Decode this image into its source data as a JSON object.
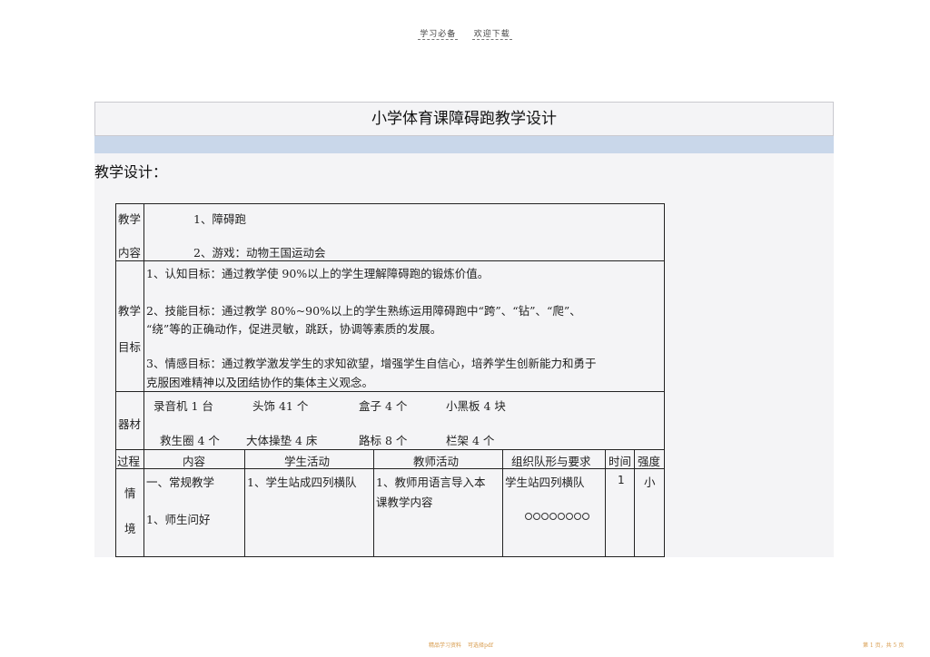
{
  "header": {
    "left": "学习必备",
    "right": "欢迎下载"
  },
  "doc": {
    "title": "小学体育课障碍跑教学设计",
    "section_label": "教学设计："
  },
  "content_row": {
    "label1": "教学",
    "label2": "内容",
    "line1": "1、障碍跑",
    "line2": "2、游戏：动物王国运动会"
  },
  "goals_row": {
    "label1": "教学",
    "label2": "目标",
    "g1": "1、认知目标：通过教学使 90%以上的学生理解障碍跑的锻炼价值。",
    "g2a": "2、技能目标：通过教学 80%~90%以上的学生熟练运用障碍跑中“跨”、“钻”、“爬”、",
    "g2b": "“绕”等的正确动作，促进灵敏，跳跃，协调等素质的发展。",
    "g3a": "3、情感目标：通过教学激发学生的求知欲望，增强学生自信心，培养学生创新能力和勇于",
    "g3b": "克服困难精神以及团结协作的集体主义观念。"
  },
  "equipment_row": {
    "label": "器材",
    "items1": [
      "录音机 1 台",
      "头饰 41 个",
      "盒子 4 个",
      "小黑板 4 块"
    ],
    "items2": [
      "救生圈 4 个",
      "大体操垫 4 床",
      "路标 8 个",
      "栏架 4 个"
    ]
  },
  "table_headers": [
    "过程",
    "内容",
    "学生活动",
    "教师活动",
    "组织队形与要求",
    "时间",
    "强度"
  ],
  "first_row": {
    "process1": "情",
    "process2": "境",
    "content1": "一、常规教学",
    "content2": "1、师生问好",
    "student": "1、学生站成四列横队",
    "teacher1": "1、教师用语言导入本",
    "teacher2": "课教学内容",
    "formation": "学生站四列横队",
    "time": "1",
    "intensity": "小"
  },
  "footer": {
    "left": "精品学习资料",
    "middle": "可选择pdf",
    "right": "第 1 页，共 5 页"
  }
}
